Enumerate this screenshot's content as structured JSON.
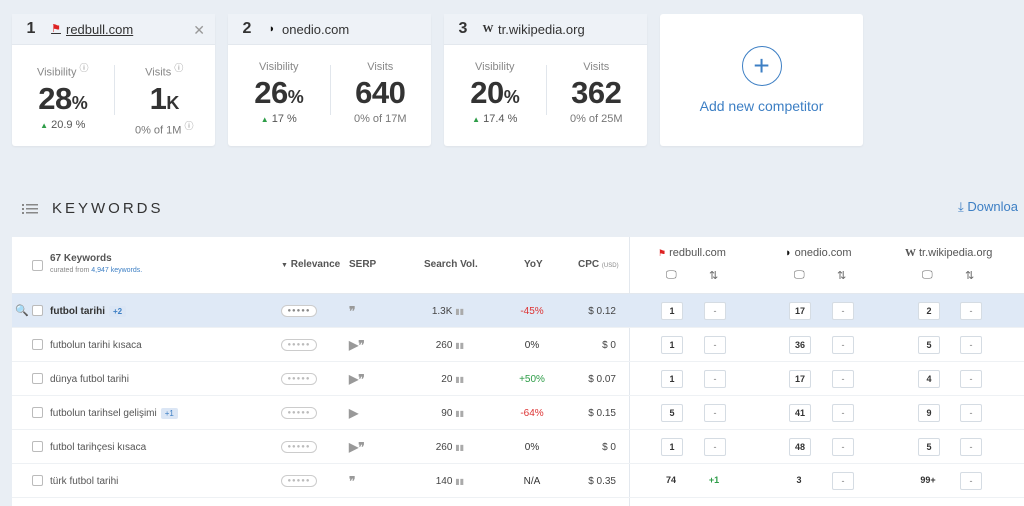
{
  "competitors": [
    {
      "rank": "1",
      "domain": "redbull.com",
      "favicon": "redbull-favicon",
      "visibility_label": "Visibility",
      "visibility": "28",
      "visibility_unit": "%",
      "visibility_change": "20.9 %",
      "visits_label": "Visits",
      "visits": "1",
      "visits_unit": "K",
      "visits_sub": "0% of 1M"
    },
    {
      "rank": "2",
      "domain": "onedio.com",
      "favicon": "onedio-favicon",
      "visibility_label": "Visibility",
      "visibility": "26",
      "visibility_unit": "%",
      "visibility_change": "17 %",
      "visits_label": "Visits",
      "visits": "640",
      "visits_sub": "0% of 17M"
    },
    {
      "rank": "3",
      "domain": "tr.wikipedia.org",
      "favicon": "wikipedia-favicon",
      "visibility_label": "Visibility",
      "visibility": "20",
      "visibility_unit": "%",
      "visibility_change": "17.4 %",
      "visits_label": "Visits",
      "visits": "362",
      "visits_sub": "0% of 25M"
    }
  ],
  "add_competitor": {
    "label": "Add new competitor"
  },
  "keywords_section": {
    "title": "KEYWORDS",
    "download": "Downloa"
  },
  "table": {
    "count_label": "67 Keywords",
    "curated": "curated from",
    "curated_link": "4,947 keywords.",
    "headers": {
      "relevance": "Relevance",
      "serp": "SERP",
      "search_vol": "Search Vol.",
      "yoy": "YoY",
      "cpc": "CPC",
      "cpc_unit": "(USD)"
    },
    "competitor_headers": [
      "redbull.com",
      "onedio.com",
      "tr.wikipedia.org"
    ],
    "rows": [
      {
        "keyword": "futbol tarihi",
        "tag": "+2",
        "vol": "1.3K",
        "yoy": "-45%",
        "yoy_type": "neg",
        "cpc": "$ 0.12",
        "p": [
          "1",
          "-",
          "17",
          "-",
          "2",
          "-"
        ]
      },
      {
        "keyword": "futbolun tarihi kısaca",
        "tag": "",
        "vol": "260",
        "yoy": "0%",
        "yoy_type": "neutral",
        "cpc": "$ 0",
        "p": [
          "1",
          "-",
          "36",
          "-",
          "5",
          "-"
        ]
      },
      {
        "keyword": "dünya futbol tarihi",
        "tag": "",
        "vol": "20",
        "yoy": "+50%",
        "yoy_type": "pos",
        "cpc": "$ 0.07",
        "p": [
          "1",
          "-",
          "17",
          "-",
          "4",
          "-"
        ]
      },
      {
        "keyword": "futbolun tarihsel gelişimi",
        "tag": "+1",
        "vol": "90",
        "yoy": "-64%",
        "yoy_type": "neg",
        "cpc": "$ 0.15",
        "p": [
          "5",
          "-",
          "41",
          "-",
          "9",
          "-"
        ]
      },
      {
        "keyword": "futbol tarihçesi kısaca",
        "tag": "",
        "vol": "260",
        "yoy": "0%",
        "yoy_type": "neutral",
        "cpc": "$ 0",
        "p": [
          "1",
          "-",
          "48",
          "-",
          "5",
          "-"
        ]
      },
      {
        "keyword": "türk futbol tarihi",
        "tag": "",
        "vol": "140",
        "yoy": "N/A",
        "yoy_type": "neutral",
        "cpc": "$ 0.35",
        "p": [
          "74",
          "+1",
          "3",
          "-",
          "99+",
          "-"
        ]
      }
    ]
  },
  "colors": {
    "accent": "#3d7fc4",
    "positive": "#2e9d48",
    "negative": "#dd3333",
    "background": "#e9eef4",
    "selected_row": "#dfe9f6"
  }
}
